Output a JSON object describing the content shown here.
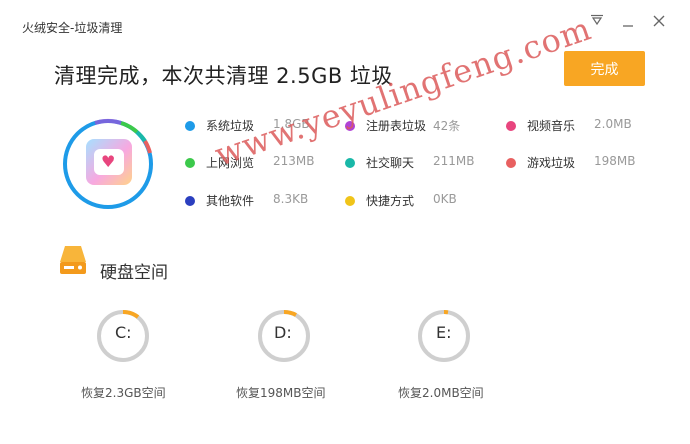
{
  "window": {
    "title": "火绒安全-垃圾清理",
    "menu_icon": "triangle-down-icon",
    "minimize_icon": "minimize-icon",
    "close_icon": "close-icon"
  },
  "summary": {
    "headline": "清理完成，本次共清理 2.5GB 垃圾",
    "done_label": "完成"
  },
  "colors": {
    "accent": "#f8a623",
    "ring": "#1e9be8"
  },
  "categories": [
    {
      "name": "系统垃圾",
      "size": "1.8GB",
      "color": "#1e9be8"
    },
    {
      "name": "注册表垃圾",
      "size": "42条",
      "color": "#b043d6"
    },
    {
      "name": "视频音乐",
      "size": "2.0MB",
      "color": "#e8457e"
    },
    {
      "name": "上网浏览",
      "size": "213MB",
      "color": "#3cc94b"
    },
    {
      "name": "社交聊天",
      "size": "211MB",
      "color": "#19b8a8"
    },
    {
      "name": "游戏垃圾",
      "size": "198MB",
      "color": "#e86060"
    },
    {
      "name": "其他软件",
      "size": "8.3KB",
      "color": "#2b3fbf"
    },
    {
      "name": "快捷方式",
      "size": "0KB",
      "color": "#f0c419"
    }
  ],
  "disk": {
    "title": "硬盘空间",
    "drives": [
      {
        "letter": "C:",
        "label": "恢复2.3GB空间"
      },
      {
        "letter": "D:",
        "label": "恢复198MB空间"
      },
      {
        "letter": "E:",
        "label": "恢复2.0MB空间"
      }
    ]
  },
  "watermark": "www.yeyulingfeng.com"
}
